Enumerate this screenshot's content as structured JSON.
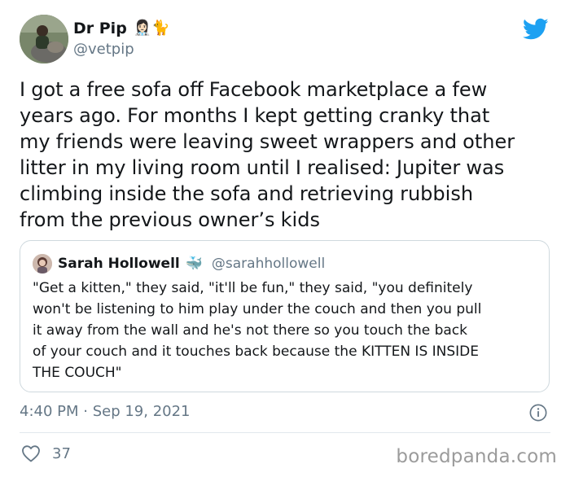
{
  "author": {
    "name": "Dr Pip",
    "emoji": "👩🏻‍⚕️🐈",
    "handle": "@vetpip"
  },
  "tweet": {
    "text": "I got a free sofa off Facebook marketplace a few\nyears ago. For months I kept getting cranky that\nmy friends were leaving sweet wrappers and other\nlitter in my living room until I realised: Jupiter was\nclimbing inside the sofa and retrieving rubbish\nfrom the previous owner’s kids"
  },
  "quoted": {
    "name": "Sarah Hollowell",
    "emoji": "🐳",
    "handle": "@sarahhollowell",
    "text": "\"Get a kitten,\" they said, \"it'll be fun,\" they said, \"you definitely\nwon't be listening to him play under the couch and then you pull\nit away from the wall and he's not there so you touch the back\nof your couch and it touches back because the KITTEN IS INSIDE\nTHE COUCH\""
  },
  "meta": {
    "timestamp": "4:40 PM · Sep 19, 2021"
  },
  "engagement": {
    "likes": "37"
  },
  "watermark": "boredpanda.com",
  "colors": {
    "twitter_blue": "#1da1f2",
    "secondary_text": "#657786",
    "border": "#cfd9de"
  }
}
